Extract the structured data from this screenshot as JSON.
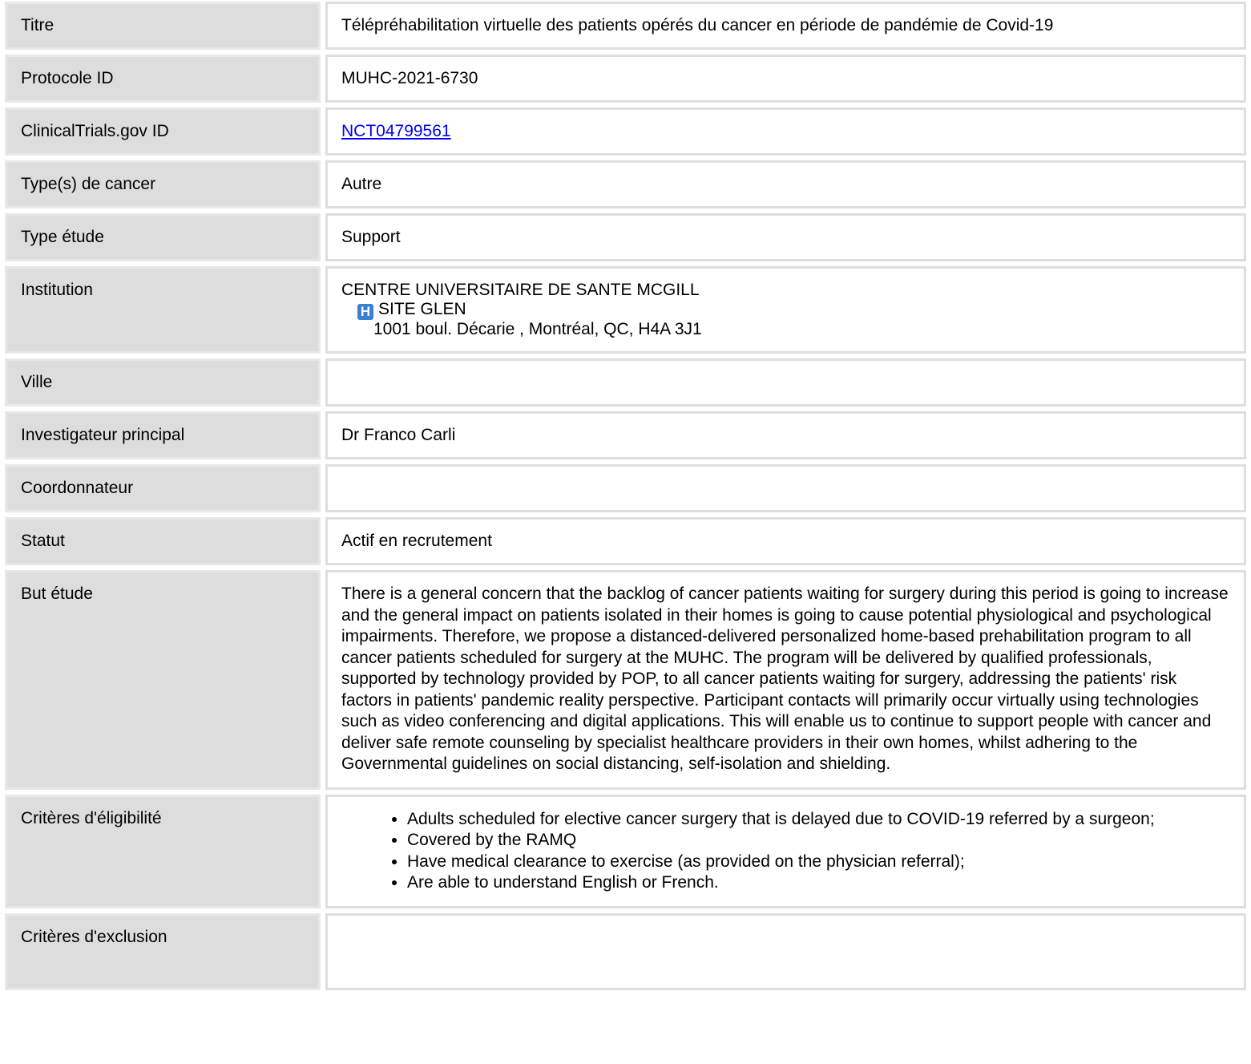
{
  "rows": {
    "titre": {
      "label": "Titre",
      "value": "Télépréhabilitation virtuelle des patients opérés du cancer en période de pandémie de Covid-19"
    },
    "protocole": {
      "label": "Protocole ID",
      "value": "MUHC-2021-6730"
    },
    "clinicaltrials": {
      "label": "ClinicalTrials.gov ID",
      "value": "NCT04799561"
    },
    "cancer_type": {
      "label": "Type(s) de cancer",
      "value": "Autre"
    },
    "type_etude": {
      "label": "Type étude",
      "value": "Support"
    },
    "institution": {
      "label": "Institution",
      "name": "CENTRE UNIVERSITAIRE DE SANTE MCGILL",
      "site_icon": "hospital-icon",
      "site_icon_glyph": "H",
      "site": "SITE GLEN",
      "address": "1001 boul. Décarie , Montréal, QC, H4A 3J1"
    },
    "ville": {
      "label": "Ville",
      "value": ""
    },
    "investigateur": {
      "label": "Investigateur principal",
      "value": "Dr Franco Carli"
    },
    "coordonnateur": {
      "label": "Coordonnateur",
      "value": ""
    },
    "statut": {
      "label": "Statut",
      "value": "Actif en recrutement"
    },
    "but": {
      "label": "But étude",
      "value": "There is a general concern that the backlog of cancer patients waiting for surgery during this period is going to increase and the general impact on patients isolated in their homes is going to cause potential physiological and psychological impairments. Therefore, we propose a distanced-delivered personalized home-based prehabilitation program to all cancer patients scheduled for surgery at the MUHC. The program will be delivered by qualified professionals, supported by technology provided by POP, to all cancer patients waiting for surgery, addressing the patients' risk factors in patients' pandemic reality perspective. Participant contacts will primarily occur virtually using technologies such as video conferencing and digital applications. This will enable us to continue to support people with cancer and deliver safe remote counseling by specialist healthcare providers in their own homes, whilst adhering to the Governmental guidelines on social distancing, self-isolation and shielding."
    },
    "eligibilite": {
      "label": "Critères d'éligibilité",
      "items": [
        "Adults scheduled for elective cancer surgery that is delayed due to COVID-19 referred by a surgeon;",
        "Covered by the RAMQ",
        "Have medical clearance to exercise (as provided on the physician referral);",
        "Are able to understand English or French."
      ]
    },
    "exclusion": {
      "label": "Critères d'exclusion",
      "value": ""
    }
  },
  "colors": {
    "label_bg": "#dddddd",
    "link": "#0000ee",
    "icon_bg": "#3b7fd4"
  }
}
